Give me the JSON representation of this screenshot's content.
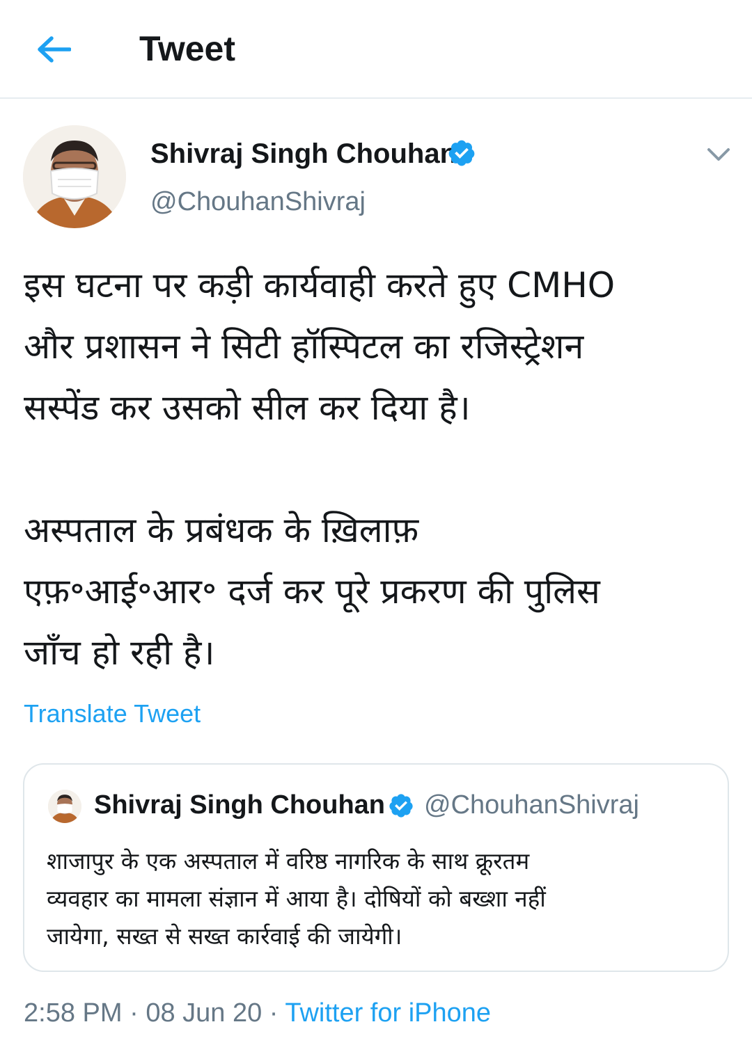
{
  "header": {
    "title": "Tweet",
    "back_icon": "arrow-left-icon",
    "accent": "#1da1f2"
  },
  "tweet": {
    "author": {
      "name": "Shivraj Singh Chouhan",
      "handle": "@ChouhanShivraj",
      "verified": true
    },
    "text_lines": [
      "इस घटना पर कड़ी कार्यवाही करते हुए CMHO",
      "और प्रशासन ने सिटी हॉस्पिटल का रजिस्ट्रेशन",
      "सस्पेंड कर उसको सील कर दिया है।",
      "",
      "अस्पताल के प्रबंधक के ख़िलाफ़",
      "एफ़॰आई॰आर॰ दर्ज कर पूरे प्रकरण की पुलिस",
      "जाँच हो रही है।"
    ],
    "translate_label": "Translate Tweet",
    "quoted": {
      "name": "Shivraj Singh Chouhan",
      "handle": "@ChouhanShivraj",
      "verified": true,
      "text_lines": [
        "शाजापुर के एक अस्पताल में वरिष्ठ नागरिक के साथ क्रूरतम",
        "व्यवहार का मामला संज्ञान में आया है। दोषियों को बख्शा नहीं",
        "जायेगा, सख्त से सख्त कार्रवाई की जायेगी।"
      ]
    },
    "meta": {
      "time": "2:58 PM",
      "separator": " · ",
      "date": "08 Jun 20",
      "source": "Twitter for iPhone"
    }
  },
  "colors": {
    "text": "#14171a",
    "secondary": "#657786",
    "link": "#1da1f2",
    "divider": "#e6ecf0"
  }
}
